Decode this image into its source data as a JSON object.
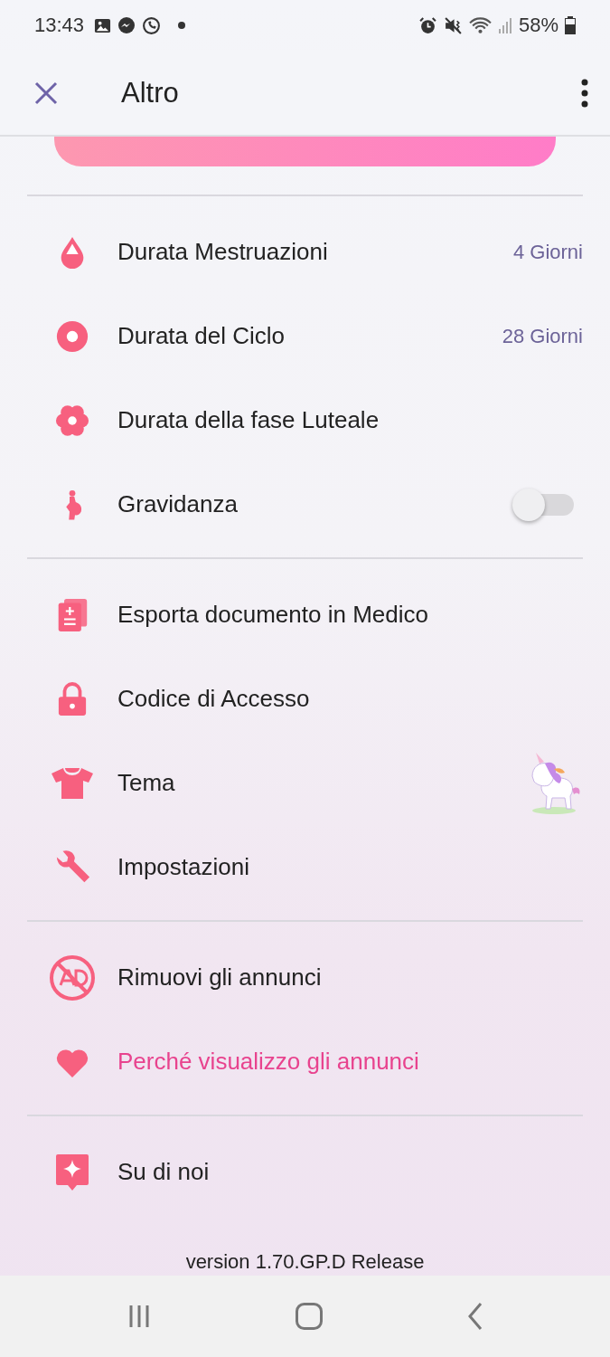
{
  "status_bar": {
    "time": "13:43",
    "battery": "58%"
  },
  "header": {
    "title": "Altro"
  },
  "sections": [
    {
      "items": [
        {
          "kind": "value",
          "label": "Durata Mestruazioni",
          "value": "4 Giorni"
        },
        {
          "kind": "value",
          "label": "Durata del Ciclo",
          "value": "28 Giorni"
        },
        {
          "kind": "plain",
          "label": "Durata della fase Luteale"
        },
        {
          "kind": "toggle",
          "label": "Gravidanza",
          "on": false
        }
      ]
    },
    {
      "items": [
        {
          "kind": "plain",
          "label": "Esporta documento in Medico"
        },
        {
          "kind": "plain",
          "label": "Codice di Accesso"
        },
        {
          "kind": "theme",
          "label": "Tema"
        },
        {
          "kind": "plain",
          "label": "Impostazioni"
        }
      ]
    },
    {
      "items": [
        {
          "kind": "plain",
          "label": "Rimuovi gli annunci"
        },
        {
          "kind": "link",
          "label": "Perché visualizzo gli annunci"
        }
      ]
    },
    {
      "items": [
        {
          "kind": "plain",
          "label": "Su di noi"
        }
      ]
    }
  ],
  "version": "version 1.70.GP.D  Release"
}
